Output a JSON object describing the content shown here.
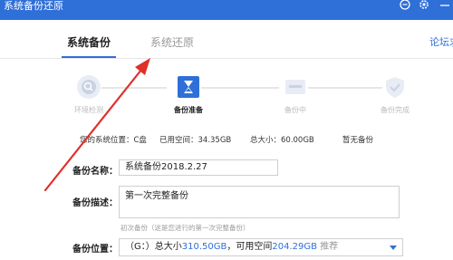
{
  "window": {
    "title": "系统备份还原"
  },
  "tabs": {
    "backup": "系统备份",
    "restore": "系统还原",
    "forum": "论坛求"
  },
  "steps": [
    {
      "label": "环境检测",
      "state": "done"
    },
    {
      "label": "备份准备",
      "state": "active"
    },
    {
      "label": "备份中",
      "state": "pending"
    },
    {
      "label": "备份完成",
      "state": "pending"
    }
  ],
  "info": {
    "system_location": "您的系统位置：C盘",
    "used_space": "已用空间：34.35GB",
    "total_size": "总大小：60.00GB",
    "backup_status": "暂无备份"
  },
  "form": {
    "name_label": "备份名称：",
    "name_value": "系统备份2018.2.27",
    "desc_label": "备份描述：",
    "desc_value": "第一次完整备份",
    "desc_hint": "初次备份（这是您进行的第一次完整备份）",
    "location_label": "备份位置：",
    "location_prefix": "（G：）总大小",
    "location_total": "310.50GB",
    "location_mid": "，可用空间",
    "location_free": "204.29GB",
    "location_suffix": "推荐"
  },
  "colors": {
    "accent": "#2f6fd8",
    "annotation": "#e0302a"
  }
}
